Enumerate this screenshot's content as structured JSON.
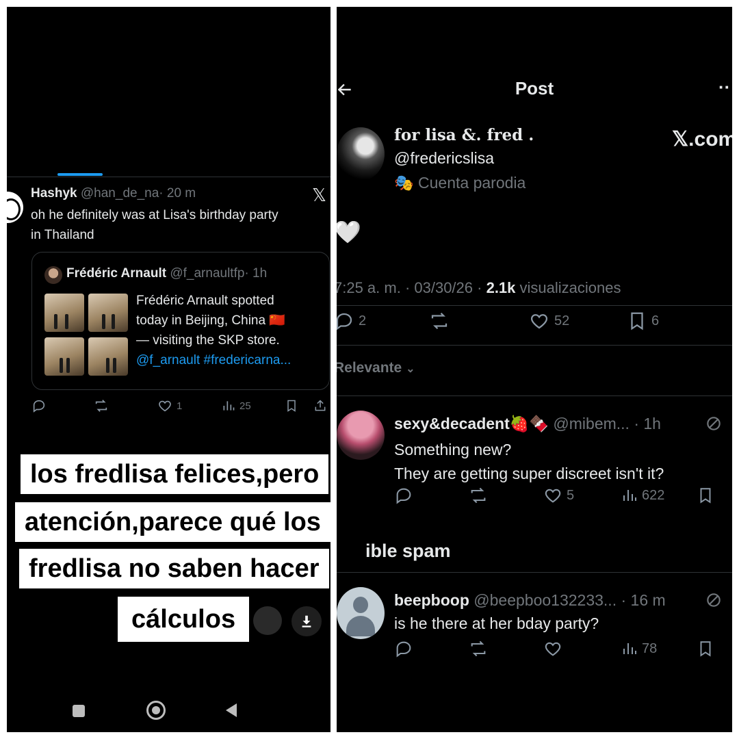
{
  "left": {
    "tweet": {
      "name": "Hashyk",
      "handle": "@han_de_na",
      "time": "· 20 m",
      "line1": "oh he definitely was at Lisa's birthday party",
      "line2": "in Thailand",
      "x_logo": "𝕏"
    },
    "quote": {
      "name": "Frédéric Arnault",
      "handle": "@f_arnaultfp",
      "time": "· 1h",
      "line1": "Frédéric Arnault spotted",
      "line2": "today in Beijing, China",
      "flag": "🇨🇳",
      "line3": "— visiting the SKP store.",
      "line4": "@f_arnault #fredericarna..."
    },
    "actions": {
      "likes": "1",
      "views": "25"
    },
    "caption": {
      "line1": "los fredlisa felices,pero",
      "line2": "atención,parece qué los",
      "line3": "fredlisa no saben hacer",
      "line4": "cálculos"
    }
  },
  "right": {
    "header": {
      "title": "Post",
      "more": "··"
    },
    "post": {
      "name": "for lisa &. fred .",
      "handle": "@fredericslisa",
      "parody_icon": "🎭",
      "parody": "Cuenta parodia",
      "watermark": "𝕏.com",
      "body": "🤍",
      "meta_time": "7:25 a. m. · 03/30/26 · ",
      "meta_views": "2.1k",
      "meta_views_label": " visualizaciones",
      "replies": "2",
      "likes": "52",
      "bookmarks": "6"
    },
    "sort_label": "Relevante",
    "reply1": {
      "name": "sexy&decadent🍓🍫",
      "handle": "@mibem...",
      "time": "· 1h",
      "line1": "Something new?",
      "line2": "They are getting super discreet isn't it?",
      "likes": "5",
      "views": "622"
    },
    "spam_label": "ible spam",
    "reply2": {
      "name": "beepboop",
      "handle": "@beepboo132233...",
      "time": "· 16 m",
      "line1": "is he there at her bday party?",
      "views": "78"
    }
  }
}
